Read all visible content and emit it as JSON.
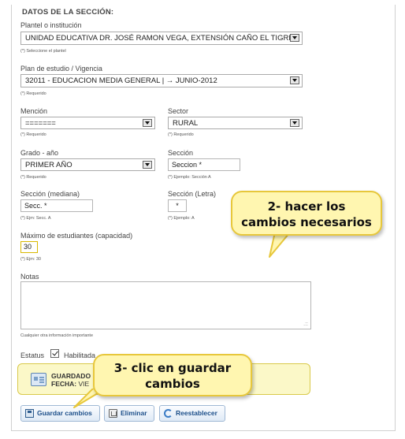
{
  "section": {
    "title": "DATOS DE LA SECCIÓN:"
  },
  "plantel": {
    "label": "Plantel o institución",
    "value": "UNIDAD EDUCATIVA DR. JOSÉ RAMON VEGA, EXTENSIÓN CAÑO EL TIGRE",
    "hint": "(*) Seleccione el plantel"
  },
  "plan": {
    "label": "Plan de estudio / Vigencia",
    "value": "32011 - EDUCACION MEDIA GENERAL   | → JUNIO-2012",
    "hint": "(*) Requerido"
  },
  "mencion": {
    "label": "Mención",
    "value": "=======",
    "hint": "(*) Requerido"
  },
  "sector": {
    "label": "Sector",
    "value": "RURAL",
    "hint": "(*) Requerido"
  },
  "grado": {
    "label": "Grado - año",
    "value": "PRIMER AÑO",
    "hint": "(*) Requerido"
  },
  "seccion": {
    "label": "Sección",
    "placeholder": "Seccion *",
    "hint": "(*) Ejemplo: Sección A"
  },
  "seccion_mediana": {
    "label": "Sección (mediana)",
    "placeholder": "Secc. *",
    "hint": "(*) Ejm: Secc. A"
  },
  "seccion_letra": {
    "label": "Sección (Letra)",
    "placeholder": "*",
    "hint": "(*) Ejemplo: A"
  },
  "capacidad": {
    "label": "Máximo de estudiantes (capacidad)",
    "value": "30",
    "hint": "(*) Ejm: 30"
  },
  "notas": {
    "label": "Notas",
    "hint": "Cualquier otra información importante"
  },
  "estatus": {
    "label": "Estatus",
    "checked": true,
    "check_label": "Habilitada"
  },
  "alert": {
    "line1": "GUARDADO",
    "line2_label": "FECHA:",
    "line2_value": "VIE"
  },
  "buttons": {
    "save": "Guardar cambios",
    "delete": "Eliminar",
    "reset": "Reestablecer"
  },
  "callouts": {
    "step2_line1": "2- hacer los",
    "step2_line2": "cambios necesarios",
    "step3_line1": "3- clic en guardar",
    "step3_line2": "cambios"
  },
  "colors": {
    "callout_fill": "#fff6b0",
    "callout_border": "#e7c73b",
    "alert_fill": "#fbf8c8",
    "button_text": "#1c4f8a"
  }
}
